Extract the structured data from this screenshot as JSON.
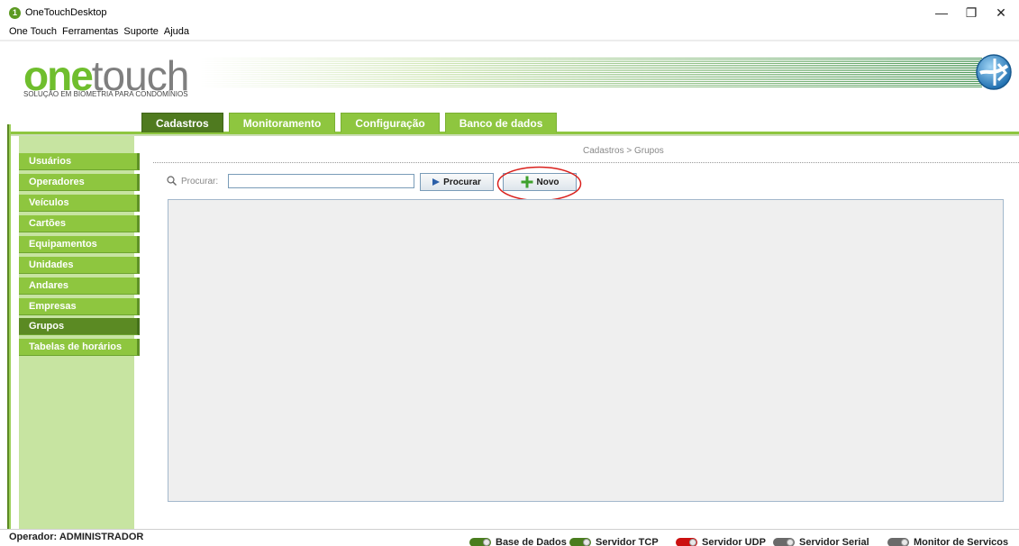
{
  "window": {
    "title": "OneTouchDesktop",
    "icon_glyph": "1",
    "controls": {
      "minimize": "—",
      "restore": "❐",
      "close": "✕"
    }
  },
  "menu": [
    "One Touch",
    "Ferramentas",
    "Suporte",
    "Ajuda"
  ],
  "logo": {
    "one": "one",
    "touch": "touch",
    "tagline": "SOLUÇÃO EM BIOMETRIA PARA CONDOMÍNIOS"
  },
  "tabs": [
    "Cadastros",
    "Monitoramento",
    "Configuração",
    "Banco de dados"
  ],
  "active_tab": "Cadastros",
  "sidebar": {
    "items": [
      "Usuários",
      "Operadores",
      "Veículos",
      "Cartões",
      "Equipamentos",
      "Unidades",
      "Andares",
      "Empresas",
      "Grupos",
      "Tabelas de horários"
    ],
    "active": "Grupos"
  },
  "breadcrumb": "Cadastros > Grupos",
  "search": {
    "label": "Procurar:",
    "value": "",
    "placeholder": ""
  },
  "buttons": {
    "procurar": "Procurar",
    "novo": "Novo"
  },
  "status": {
    "operator": "Operador: ADMINISTRADOR",
    "services": [
      {
        "label": "Base de Dados",
        "color": "#4a7d1e"
      },
      {
        "label": "Servidor TCP",
        "color": "#4a7d1e"
      },
      {
        "label": "Servidor UDP",
        "color": "#cc1010"
      },
      {
        "label": "Servidor Serial",
        "color": "#6a6a6a"
      },
      {
        "label": "Monitor de Servicos",
        "color": "#6a6a6a"
      }
    ]
  },
  "colors": {
    "accent_green": "#8ec63f",
    "dark_green": "#4f7a1f",
    "sidebar_bg": "#c7e4a1",
    "highlight_red": "#d9201c"
  }
}
